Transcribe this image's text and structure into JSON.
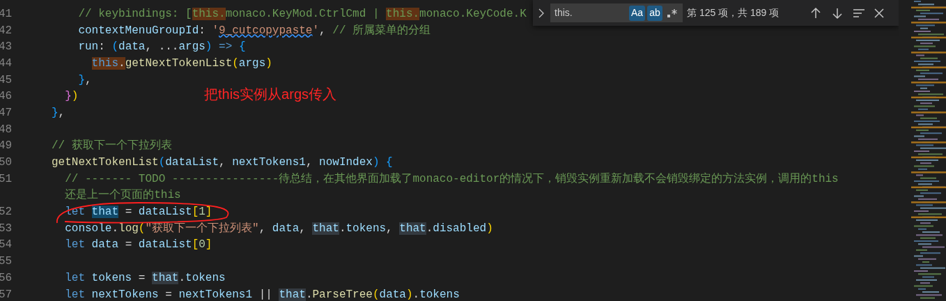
{
  "editor": {
    "lines": [
      {
        "number": "41",
        "segments": [
          {
            "text": "    // keybindings: [",
            "kind": "comment"
          },
          {
            "text": "this.",
            "kind": "comment",
            "find_match": true
          },
          {
            "text": "monaco.KeyMod.CtrlCmd | ",
            "kind": "comment"
          },
          {
            "text": "this.",
            "kind": "comment",
            "find_match": true
          },
          {
            "text": "monaco.KeyCode.K",
            "kind": "comment"
          }
        ]
      },
      {
        "number": "42",
        "segments": [
          {
            "text": "    contextMenuGroupId",
            "kind": "variable"
          },
          {
            "text": ": ",
            "kind": "plain"
          },
          {
            "text": "'",
            "kind": "string"
          },
          {
            "text": "9_cutcopypaste",
            "kind": "string",
            "warning": true
          },
          {
            "text": "'",
            "kind": "string"
          },
          {
            "text": ", ",
            "kind": "plain"
          },
          {
            "text": "// 所属菜单的分组",
            "kind": "comment"
          }
        ]
      },
      {
        "number": "43",
        "segments": [
          {
            "text": "    run",
            "kind": "variable"
          },
          {
            "text": ": ",
            "kind": "plain"
          },
          {
            "text": "(",
            "kind": "bracket-blue"
          },
          {
            "text": "data",
            "kind": "variable"
          },
          {
            "text": ", ...",
            "kind": "plain"
          },
          {
            "text": "args",
            "kind": "variable"
          },
          {
            "text": ") ",
            "kind": "bracket-blue"
          },
          {
            "text": "=> ",
            "kind": "keyword"
          },
          {
            "text": "{",
            "kind": "bracket-blue"
          }
        ]
      },
      {
        "number": "44",
        "segments": [
          {
            "text": "      this",
            "kind": "keyword",
            "find_match": true
          },
          {
            "text": ".",
            "kind": "plain",
            "find_match": true
          },
          {
            "text": "getNextTokenList",
            "kind": "function"
          },
          {
            "text": "(",
            "kind": "bracket-gold"
          },
          {
            "text": "args",
            "kind": "variable"
          },
          {
            "text": ")",
            "kind": "bracket-gold"
          }
        ]
      },
      {
        "number": "45",
        "segments": [
          {
            "text": "    }",
            "kind": "bracket-blue"
          },
          {
            "text": ",",
            "kind": "plain"
          }
        ]
      },
      {
        "number": "46",
        "segments": [
          {
            "text": "  }",
            "kind": "bracket-purple"
          },
          {
            "text": ")",
            "kind": "bracket-gold"
          }
        ]
      },
      {
        "number": "47",
        "segments": [
          {
            "text": "}",
            "kind": "bracket-blue"
          },
          {
            "text": ",",
            "kind": "plain"
          }
        ]
      },
      {
        "number": "48"
      },
      {
        "number": "49",
        "segments": [
          {
            "text": "// 获取下一个下拉列表",
            "kind": "comment"
          }
        ]
      },
      {
        "number": "50",
        "segments": [
          {
            "text": "getNextTokenList",
            "kind": "function"
          },
          {
            "text": "(",
            "kind": "bracket-blue"
          },
          {
            "text": "dataList",
            "kind": "variable"
          },
          {
            "text": ", ",
            "kind": "plain"
          },
          {
            "text": "nextTokens1",
            "kind": "variable"
          },
          {
            "text": ", ",
            "kind": "plain"
          },
          {
            "text": "nowIndex",
            "kind": "variable"
          },
          {
            "text": ") ",
            "kind": "bracket-blue"
          },
          {
            "text": "{",
            "kind": "bracket-blue"
          }
        ]
      },
      {
        "number": "51",
        "segments": [
          {
            "text": "  // ------- TODO ----------------待总结，在其他界面加载了monaco-editor的情况下，销毁实例重新加载不会销毁绑定的方法实例，调用的this",
            "kind": "comment"
          }
        ]
      },
      {
        "segments": [
          {
            "text": "  还是上一个页面的this",
            "kind": "comment"
          }
        ]
      },
      {
        "number": "52",
        "segments": [
          {
            "text": "  let ",
            "kind": "keyword"
          },
          {
            "text": "that",
            "kind": "variable",
            "selected": true
          },
          {
            "text": " = ",
            "kind": "plain"
          },
          {
            "text": "dataList",
            "kind": "variable"
          },
          {
            "text": "[",
            "kind": "bracket-gold"
          },
          {
            "text": "1",
            "kind": "number"
          },
          {
            "text": "]",
            "kind": "bracket-gold"
          }
        ]
      },
      {
        "number": "53",
        "segments": [
          {
            "text": "  console",
            "kind": "variable"
          },
          {
            "text": ".",
            "kind": "plain"
          },
          {
            "text": "log",
            "kind": "function"
          },
          {
            "text": "(",
            "kind": "bracket-gold"
          },
          {
            "text": "\"获取下一个下拉列表\"",
            "kind": "string"
          },
          {
            "text": ", ",
            "kind": "plain"
          },
          {
            "text": "data",
            "kind": "variable"
          },
          {
            "text": ", ",
            "kind": "plain"
          },
          {
            "text": "that",
            "kind": "variable",
            "occurrence": true
          },
          {
            "text": ".",
            "kind": "plain"
          },
          {
            "text": "tokens",
            "kind": "variable"
          },
          {
            "text": ", ",
            "kind": "plain"
          },
          {
            "text": "that",
            "kind": "variable",
            "occurrence": true
          },
          {
            "text": ".",
            "kind": "plain"
          },
          {
            "text": "disabled",
            "kind": "variable"
          },
          {
            "text": ")",
            "kind": "bracket-gold"
          }
        ]
      },
      {
        "number": "54",
        "segments": [
          {
            "text": "  let ",
            "kind": "keyword"
          },
          {
            "text": "data",
            "kind": "variable"
          },
          {
            "text": " = ",
            "kind": "plain"
          },
          {
            "text": "dataList",
            "kind": "variable"
          },
          {
            "text": "[",
            "kind": "bracket-gold"
          },
          {
            "text": "0",
            "kind": "number"
          },
          {
            "text": "]",
            "kind": "bracket-gold"
          }
        ]
      },
      {
        "number": "55"
      },
      {
        "number": "56",
        "segments": [
          {
            "text": "  let ",
            "kind": "keyword"
          },
          {
            "text": "tokens",
            "kind": "variable"
          },
          {
            "text": " = ",
            "kind": "plain"
          },
          {
            "text": "that",
            "kind": "variable",
            "occurrence": true
          },
          {
            "text": ".",
            "kind": "plain"
          },
          {
            "text": "tokens",
            "kind": "variable"
          }
        ]
      },
      {
        "number": "57",
        "segments": [
          {
            "text": "  let ",
            "kind": "keyword"
          },
          {
            "text": "nextTokens",
            "kind": "variable"
          },
          {
            "text": " = ",
            "kind": "plain"
          },
          {
            "text": "nextTokens1",
            "kind": "variable"
          },
          {
            "text": " || ",
            "kind": "plain"
          },
          {
            "text": "that",
            "kind": "variable",
            "occurrence": true
          },
          {
            "text": ".",
            "kind": "plain"
          },
          {
            "text": "ParseTree",
            "kind": "function"
          },
          {
            "text": "(",
            "kind": "bracket-gold"
          },
          {
            "text": "data",
            "kind": "variable"
          },
          {
            "text": ")",
            "kind": "bracket-gold"
          },
          {
            "text": ".",
            "kind": "plain"
          },
          {
            "text": "tokens",
            "kind": "variable"
          }
        ]
      }
    ]
  },
  "annotation": {
    "text": "把this实例从args传入"
  },
  "find_widget": {
    "query": "this.",
    "toggles": [
      {
        "kind": "text",
        "label": "Aa",
        "selected": true
      },
      {
        "kind": "text",
        "label": "ab",
        "selected": true
      },
      {
        "kind": "regex",
        "selected": false
      }
    ],
    "result_count": "第 125 项，共 189 项"
  }
}
